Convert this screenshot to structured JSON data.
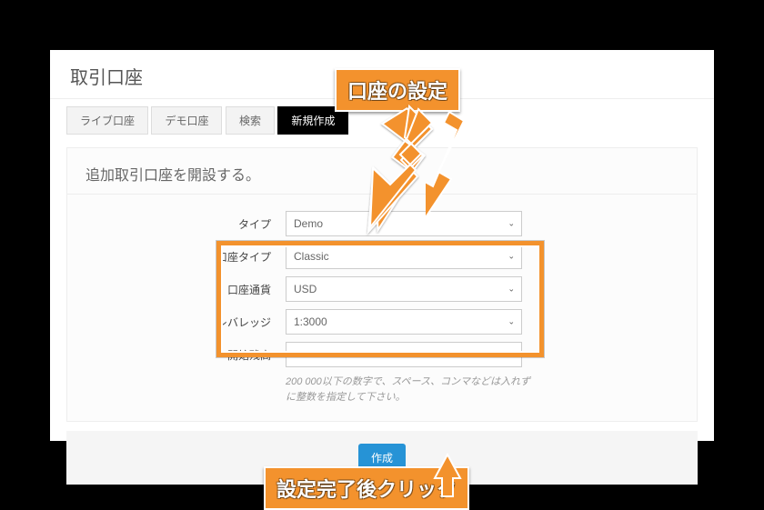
{
  "page": {
    "title": "取引口座"
  },
  "tabs": {
    "live": "ライブ口座",
    "demo": "デモ口座",
    "search": "検索",
    "create": "新規作成"
  },
  "panel": {
    "title": "追加取引口座を開設する。"
  },
  "fields": {
    "type": {
      "label": "タイプ",
      "value": "Demo"
    },
    "accountType": {
      "label": "口座タイプ",
      "value": "Classic"
    },
    "currency": {
      "label": "口座通貨",
      "value": "USD"
    },
    "leverage": {
      "label": "レバレッジ",
      "value": "1:3000"
    },
    "balance": {
      "label": "開始残高",
      "value": "",
      "help": "200 000以下の数字で、スペース、コンマなどは入れずに整数を指定して下さい。"
    }
  },
  "actions": {
    "submit": "作成"
  },
  "annotations": {
    "settings_label": "口座の設定",
    "click_label": "設定完了後クリック"
  }
}
